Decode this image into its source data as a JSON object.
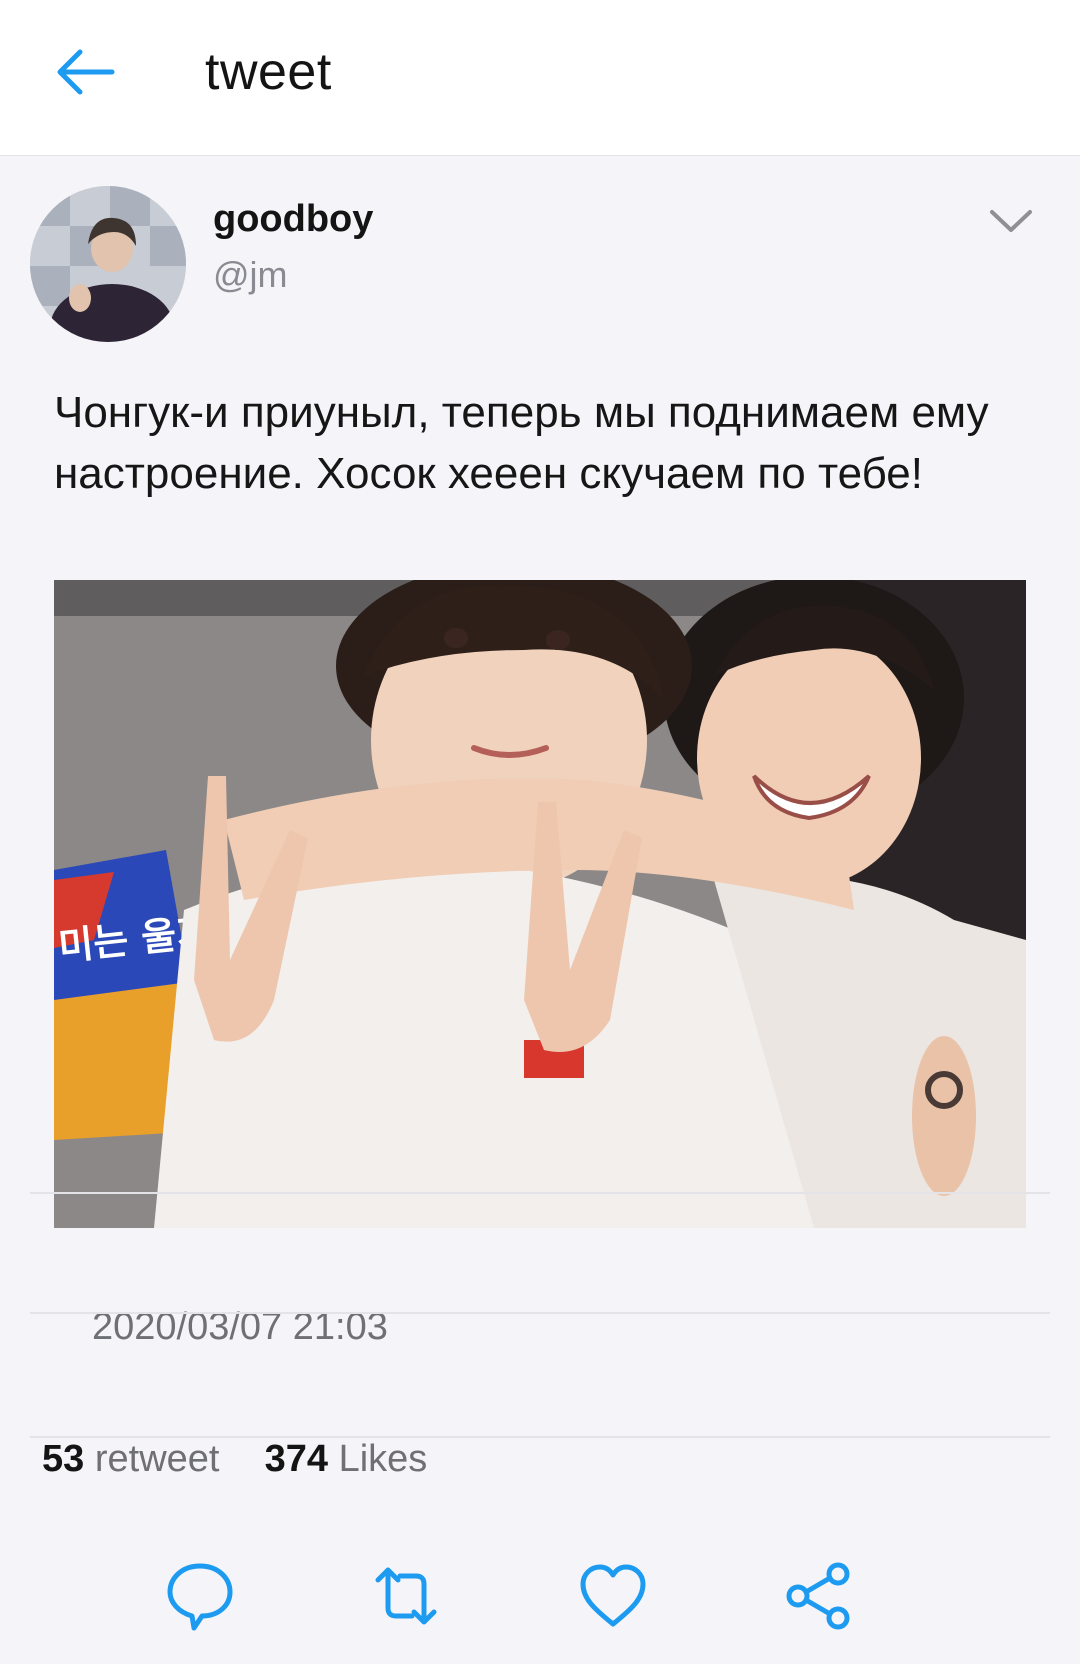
{
  "header": {
    "title": "tweet",
    "back_icon": "arrow-left-icon",
    "accent_color": "#1d9bf0"
  },
  "tweet": {
    "author": {
      "display_name": "goodboy",
      "handle": "@jm"
    },
    "menu_icon": "chevron-down-icon",
    "text": "Чонгук-и приуныл, теперь мы поднимаем ему настроение. Хосок хееен скучаем по тебе!",
    "media": {
      "sign_text": "미는 울기"
    },
    "timestamp": "2020/03/07 21:03",
    "stats": {
      "retweet_count": "53",
      "retweet_label": "retweet",
      "like_count": "374",
      "like_label": "Likes"
    },
    "actions": [
      {
        "name": "reply",
        "icon": "speech-bubble-icon"
      },
      {
        "name": "retweet",
        "icon": "retweet-icon"
      },
      {
        "name": "like",
        "icon": "heart-icon"
      },
      {
        "name": "share",
        "icon": "share-icon"
      }
    ]
  }
}
